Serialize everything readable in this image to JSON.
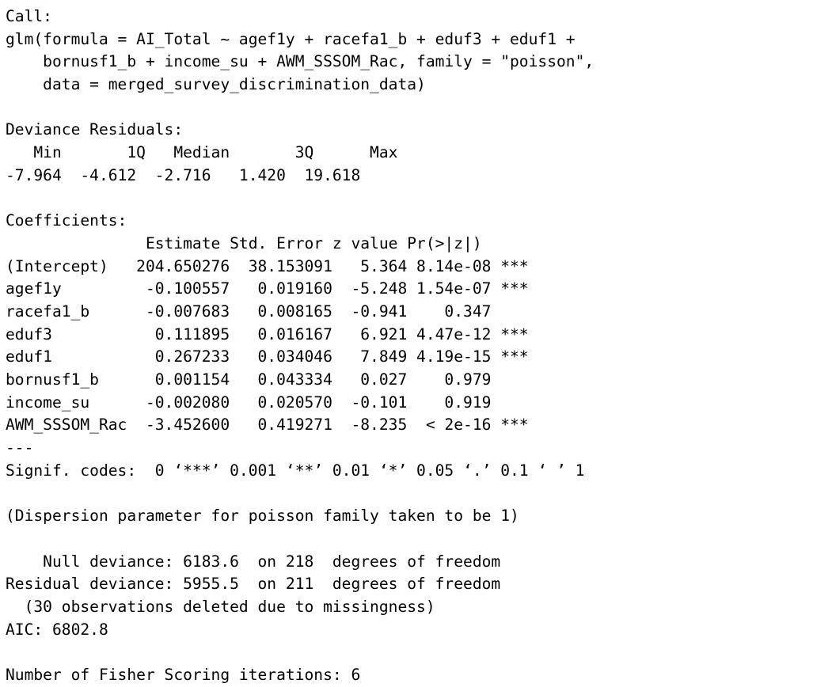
{
  "output": {
    "lines": [
      "Call:",
      "glm(formula = AI_Total ~ agef1y + racefa1_b + eduf3 + eduf1 +",
      "    bornusf1_b + income_su + AWM_SSSOM_Rac, family = \"poisson\",",
      "    data = merged_survey_discrimination_data)",
      "",
      "Deviance Residuals:",
      "   Min       1Q   Median       3Q      Max",
      "-7.964  -4.612  -2.716   1.420  19.618",
      "",
      "Coefficients:",
      "               Estimate Std. Error z value Pr(>|z|)",
      "(Intercept)   204.650276  38.153091   5.364 8.14e-08 ***",
      "agef1y         -0.100557   0.019160  -5.248 1.54e-07 ***",
      "racefa1_b      -0.007683   0.008165  -0.941    0.347",
      "eduf3           0.111895   0.016167   6.921 4.47e-12 ***",
      "eduf1           0.267233   0.034046   7.849 4.19e-15 ***",
      "bornusf1_b      0.001154   0.043334   0.027    0.979",
      "income_su      -0.002080   0.020570  -0.101    0.919",
      "AWM_SSSOM_Rac  -3.452600   0.419271  -8.235  < 2e-16 ***",
      "---",
      "Signif. codes:  0 ‘***’ 0.001 ‘**’ 0.01 ‘*’ 0.05 ‘.’ 0.1 ‘ ’ 1",
      "",
      "(Dispersion parameter for poisson family taken to be 1)",
      "",
      "    Null deviance: 6183.6  on 218  degrees of freedom",
      "Residual deviance: 5955.5  on 211  degrees of freedom",
      "  (30 observations deleted due to missingness)",
      "AIC: 6802.8",
      "",
      "Number of Fisher Scoring iterations: 6"
    ]
  }
}
